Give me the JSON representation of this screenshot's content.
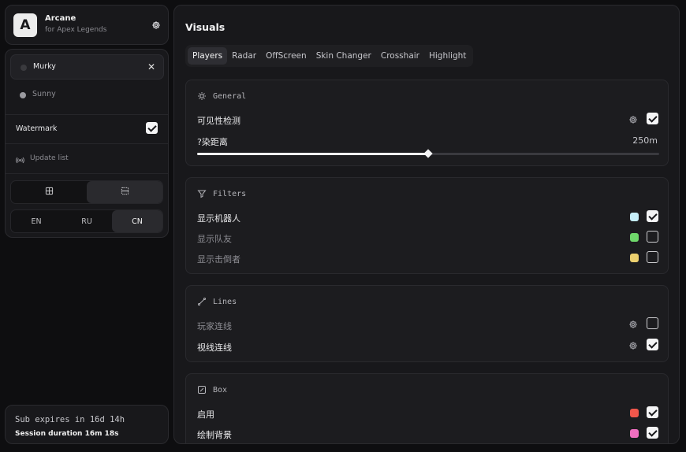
{
  "brand": {
    "logo_letter": "A",
    "name": "Arcane",
    "subtitle": "for Apex Legends",
    "settings_icon": "gear-icon"
  },
  "configs": {
    "items": [
      {
        "label": "Murky",
        "active": true,
        "dot_color": "#3a3a3e"
      },
      {
        "label": "Sunny",
        "active": false,
        "dot_color": "#9a9aa0"
      }
    ],
    "watermark_label": "Watermark",
    "watermark_checked": true,
    "update_label": "Update list",
    "layout_options": [
      "grid-icon",
      "list-icon"
    ],
    "layout_selected": 1,
    "languages": [
      "EN",
      "RU",
      "CN"
    ],
    "language_selected": "CN"
  },
  "subscription": {
    "expires": "Sub expires in 16d 14h",
    "session": "Session duration 16m 18s"
  },
  "main": {
    "title": "Visuals",
    "tabs": [
      "Players",
      "Radar",
      "OffScreen",
      "Skin Changer",
      "Crosshair",
      "Highlight"
    ],
    "selected_tab": "Players"
  },
  "sections": {
    "general": {
      "title": "General",
      "visibility_label": "可见性检测",
      "visibility_checked": true,
      "distance_label": "?染距离",
      "distance_value": "250m",
      "distance_fraction": 0.5
    },
    "filters": {
      "title": "Filters",
      "items": [
        {
          "label": "显示机器人",
          "color": "#c6eef9",
          "checked": true
        },
        {
          "label": "显示队友",
          "color": "#6fd86b",
          "checked": false
        },
        {
          "label": "显示击倒者",
          "color": "#ecd06f",
          "checked": false
        }
      ]
    },
    "lines": {
      "title": "Lines",
      "items": [
        {
          "label": "玩家连线",
          "checked": false
        },
        {
          "label": "视线连线",
          "checked": true
        }
      ]
    },
    "box": {
      "title": "Box",
      "items": [
        {
          "label": "启用",
          "color": "#f0574b",
          "checked": true
        },
        {
          "label": "绘制背景",
          "color": "#f06fc0",
          "checked": true
        }
      ]
    }
  }
}
